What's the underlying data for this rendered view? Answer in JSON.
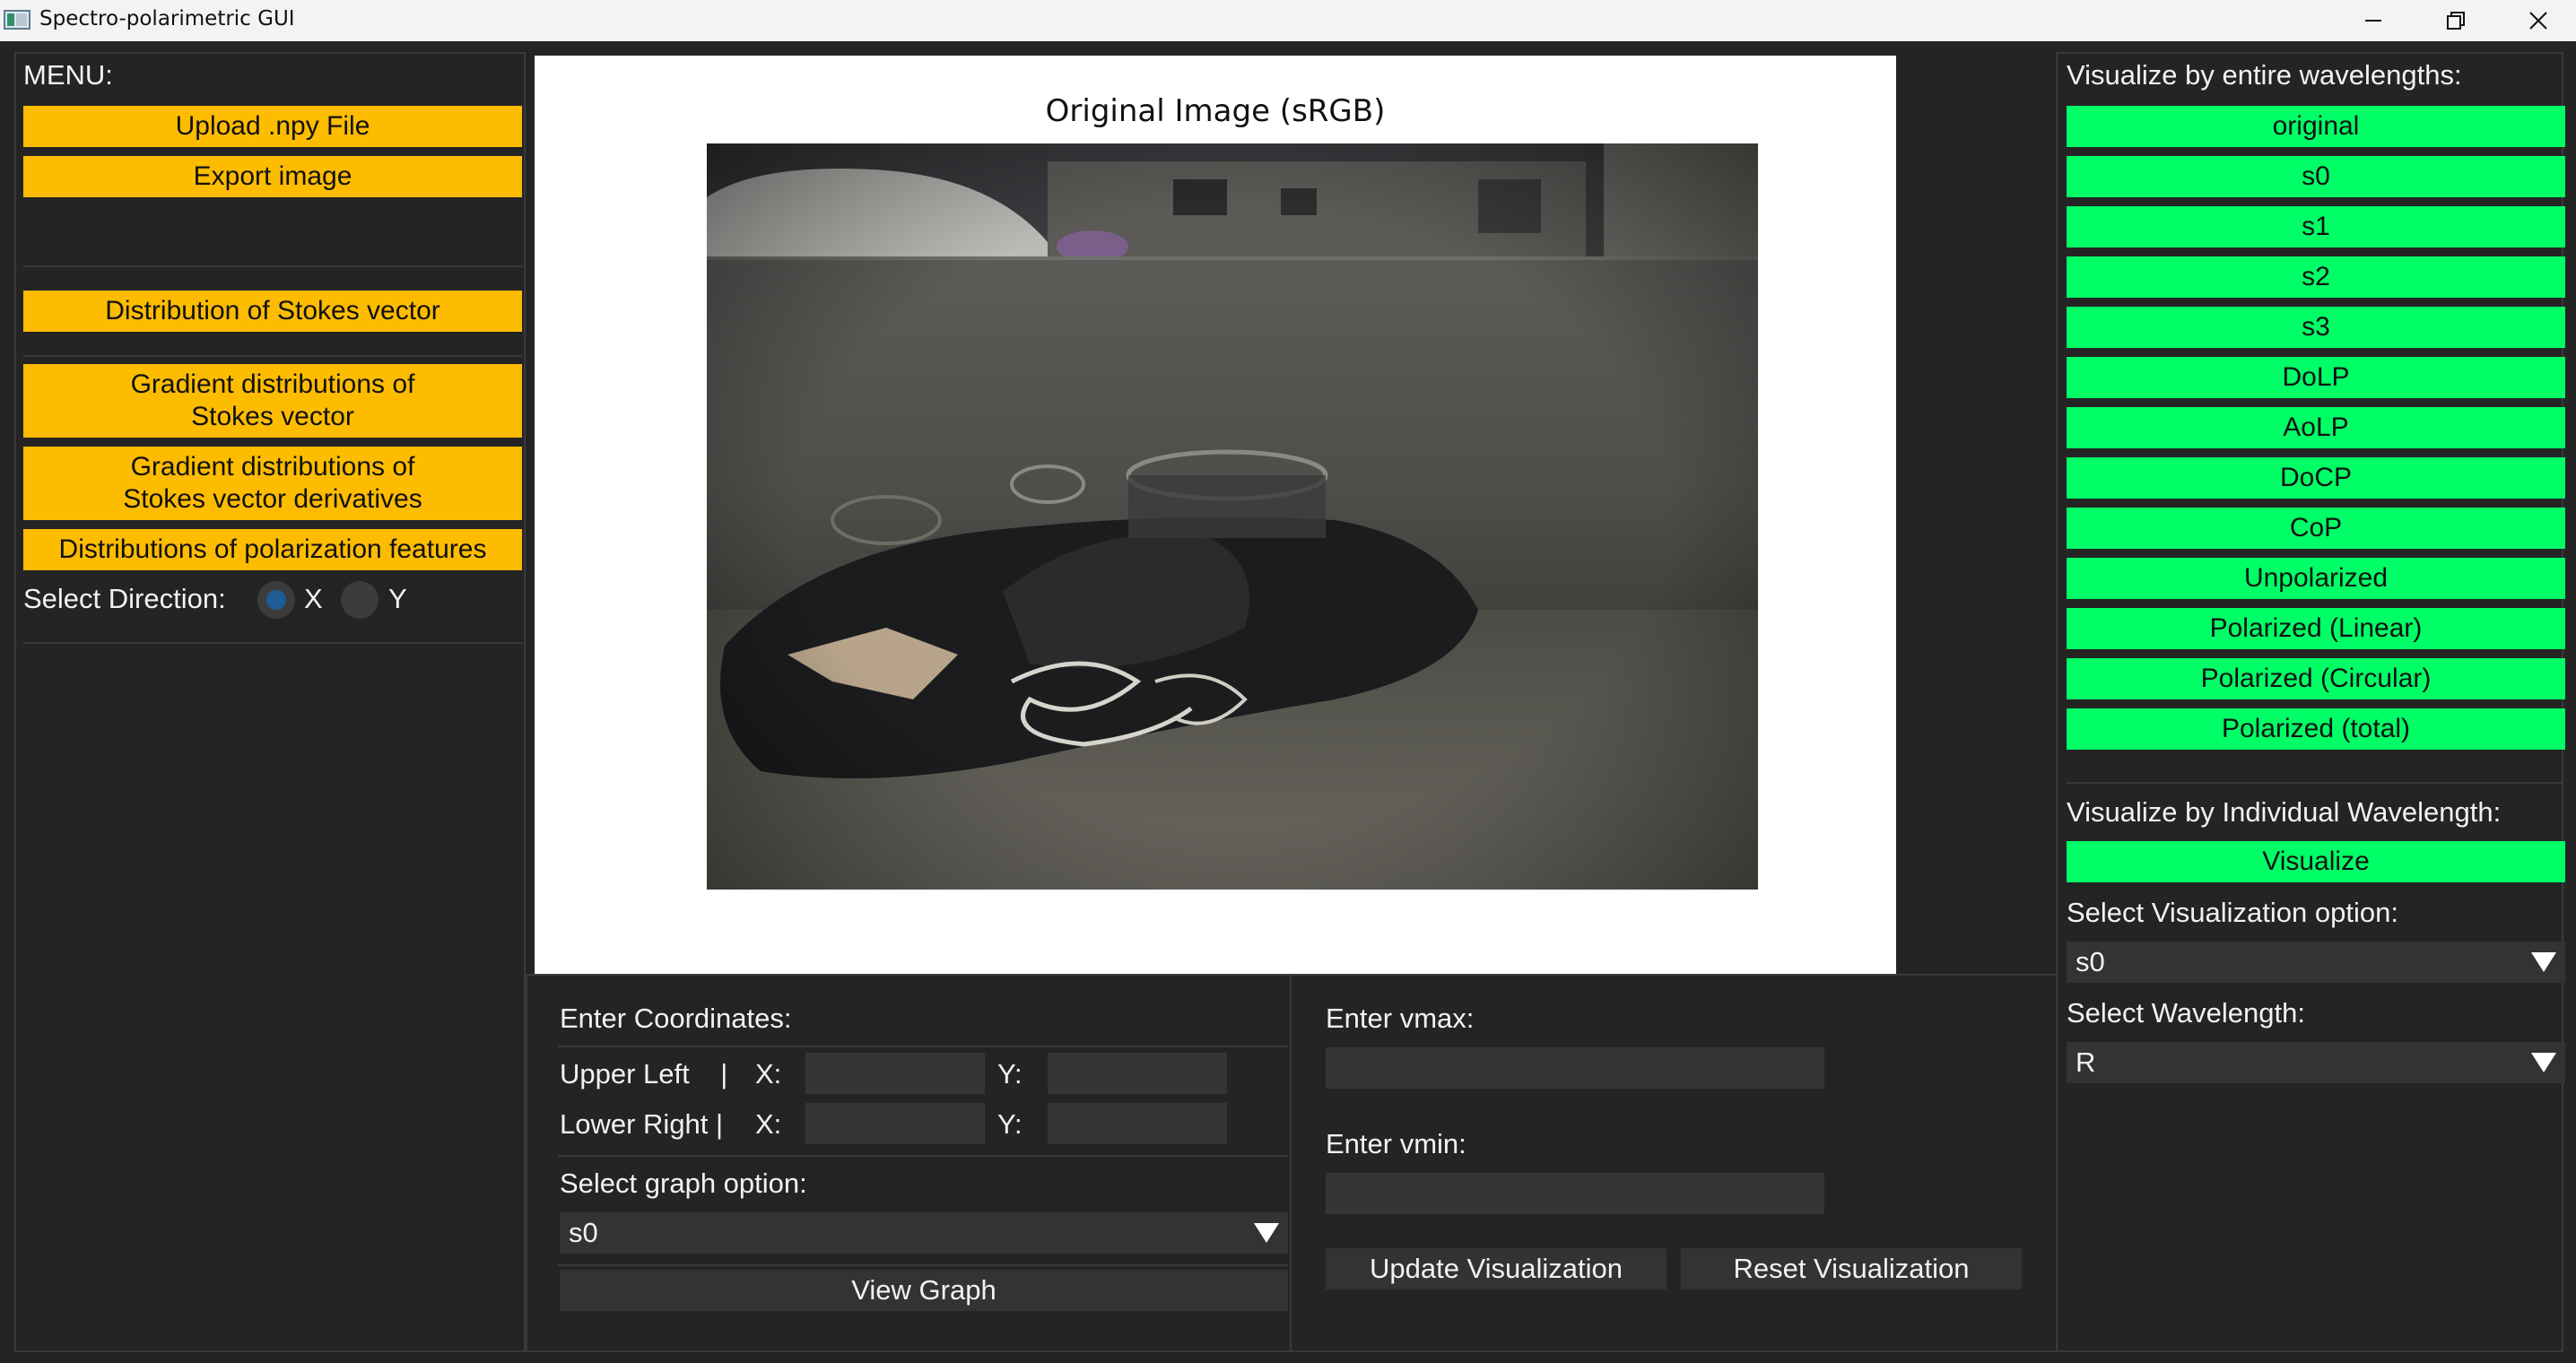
{
  "window": {
    "title": "Spectro-polarimetric GUI",
    "minimize_icon": "minimize-icon",
    "restore_icon": "restore-icon",
    "close_icon": "close-icon"
  },
  "left_menu": {
    "title": "MENU:",
    "upload_label": "Upload .npy File",
    "export_label": "Export image",
    "stokes_dist_label": "Distribution of Stokes vector",
    "grad_stokes_line1": "Gradient distributions of",
    "grad_stokes_line2": "Stokes vector",
    "grad_deriv_line1": "Gradient distributions of",
    "grad_deriv_line2": "Stokes vector derivatives",
    "polar_features_label": "Distributions of polarization features",
    "direction_label": "Select Direction:",
    "direction_options": [
      "X",
      "Y"
    ],
    "direction_selected": "X"
  },
  "image_panel": {
    "title": "Original Image (sRGB)"
  },
  "coords": {
    "title": "Enter Coordinates:",
    "upper_left_label": "Upper Left    |",
    "lower_right_label": "Lower Right |",
    "x_label": "X:",
    "y_label": "Y:",
    "upper_left_x": "",
    "upper_left_y": "",
    "lower_right_x": "",
    "lower_right_y": "",
    "graph_option_label": "Select graph option:",
    "graph_option_value": "s0",
    "view_graph_label": "View Graph"
  },
  "vrange": {
    "vmax_label": "Enter vmax:",
    "vmax_value": "",
    "vmin_label": "Enter vmin:",
    "vmin_value": "",
    "update_label": "Update Visualization",
    "reset_label": "Reset Visualization"
  },
  "right_panel": {
    "entire_title": "Visualize by entire wavelengths:",
    "entire_buttons": [
      "original",
      "s0",
      "s1",
      "s2",
      "s3",
      "DoLP",
      "AoLP",
      "DoCP",
      "CoP",
      "Unpolarized",
      "Polarized (Linear)",
      "Polarized (Circular)",
      "Polarized (total)"
    ],
    "individual_title": "Visualize by Individual Wavelength:",
    "visualize_label": "Visualize",
    "vis_option_label": "Select Visualization option:",
    "vis_option_value": "s0",
    "wavelength_label": "Select Wavelength:",
    "wavelength_value": "R"
  },
  "colors": {
    "background": "#242424",
    "yellow_button": "#fdbc00",
    "green_button": "#00ff66",
    "radio_selected": "#1f5c94"
  }
}
